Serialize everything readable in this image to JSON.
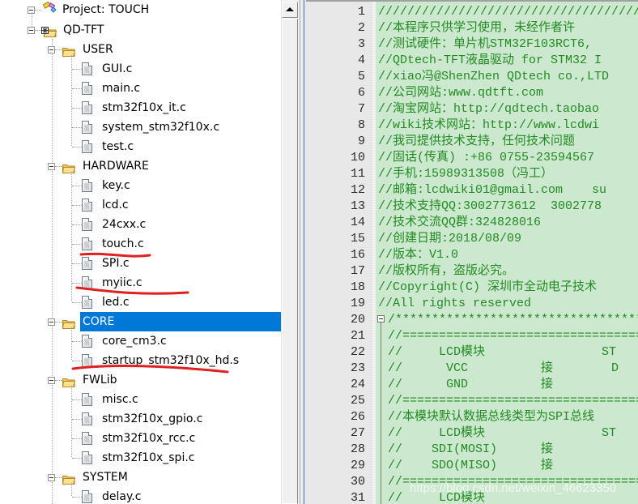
{
  "tree": {
    "project_label": "Project: TOUCH",
    "target_label": "QD-TFT",
    "groups": [
      {
        "name": "USER",
        "files": [
          "GUI.c",
          "main.c",
          "stm32f10x_it.c",
          "system_stm32f10x.c",
          "test.c"
        ]
      },
      {
        "name": "HARDWARE",
        "files": [
          "key.c",
          "lcd.c",
          "24cxx.c",
          "touch.c",
          "SPI.c",
          "myiic.c",
          "led.c"
        ]
      },
      {
        "name": "CORE",
        "selected": true,
        "files": [
          "core_cm3.c",
          "startup_stm32f10x_hd.s"
        ]
      },
      {
        "name": "FWLib",
        "files": [
          "misc.c",
          "stm32f10x_gpio.c",
          "stm32f10x_rcc.c",
          "stm32f10x_spi.c"
        ]
      },
      {
        "name": "SYSTEM",
        "files": [
          "delay.c"
        ]
      }
    ],
    "annotated_files": [
      "touch.c",
      "myiic.c",
      "startup_stm32f10x_hd.s"
    ]
  },
  "editor": {
    "lines": [
      {
        "no": "1",
        "text": "////////////////////////////////////"
      },
      {
        "no": "2",
        "text": "//本程序只供学习使用，未经作者许"
      },
      {
        "no": "3",
        "text": "//测试硬件：单片机STM32F103RCT6,"
      },
      {
        "no": "4",
        "text": "//QDtech-TFT液晶驱动 for STM32 I"
      },
      {
        "no": "5",
        "text": "//xiao冯@ShenZhen QDtech co.,LTD"
      },
      {
        "no": "6",
        "text": "//公司网站:www.qdtft.com"
      },
      {
        "no": "7",
        "text": "//淘宝网站：http://qdtech.taobao"
      },
      {
        "no": "8",
        "text": "//wiki技术网站：http://www.lcdwi"
      },
      {
        "no": "9",
        "text": "//我司提供技术支持，任何技术问题"
      },
      {
        "no": "10",
        "text": "//固话(传真) :+86 0755-23594567"
      },
      {
        "no": "11",
        "text": "//手机:15989313508（冯工）"
      },
      {
        "no": "12",
        "text": "//邮箱:lcdwiki01@gmail.com    su"
      },
      {
        "no": "13",
        "text": "//技术支持QQ:3002773612  3002778"
      },
      {
        "no": "14",
        "text": "//技术交流QQ群:324828016"
      },
      {
        "no": "15",
        "text": "//创建日期:2018/08/09"
      },
      {
        "no": "16",
        "text": "//版本：V1.0"
      },
      {
        "no": "17",
        "text": "//版权所有，盗版必究。"
      },
      {
        "no": "18",
        "text": "//Copyright(C) 深圳市全动电子技术"
      },
      {
        "no": "19",
        "text": "//All rights reserved"
      },
      {
        "no": "20",
        "text": "/**********************************"
      },
      {
        "no": "21",
        "text": "//================================="
      },
      {
        "no": "22",
        "text": "//     LCD模块                ST"
      },
      {
        "no": "23",
        "text": "//      VCC          接        D"
      },
      {
        "no": "24",
        "text": "//      GND          接"
      },
      {
        "no": "25",
        "text": "//================================="
      },
      {
        "no": "26",
        "text": "//本模块默认数据总线类型为SPI总线"
      },
      {
        "no": "27",
        "text": "//     LCD模块                ST"
      },
      {
        "no": "28",
        "text": "//    SDI(MOSI)      接"
      },
      {
        "no": "29",
        "text": "//    SDO(MISO)      接"
      },
      {
        "no": "30",
        "text": "//================================="
      },
      {
        "no": "31",
        "text": "//     LCD模块"
      }
    ]
  },
  "watermark": "https://blog.csdn.net/weixin_46623350",
  "colors": {
    "selection": "#0078d7",
    "editor_bg": "#cce8cf",
    "comment": "#228b22",
    "annotation": "#e02020"
  }
}
